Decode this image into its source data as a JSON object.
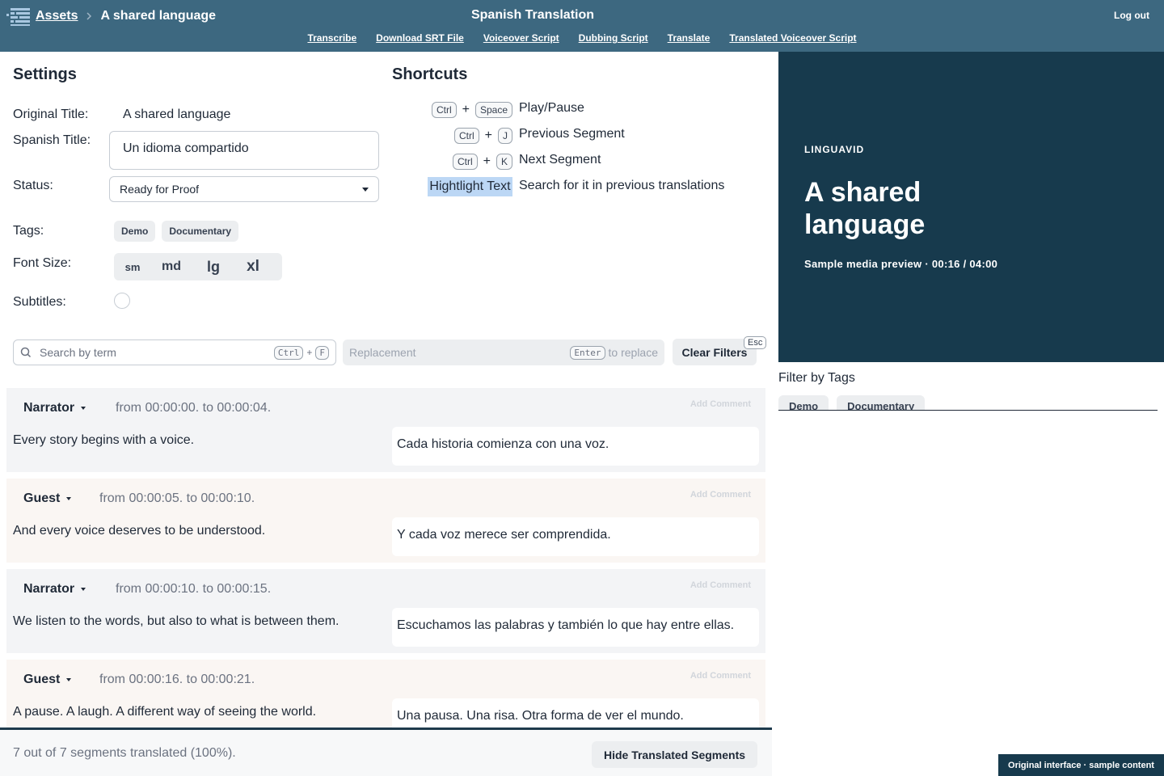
{
  "header": {
    "breadcrumb_root": "Assets",
    "breadcrumb_current": "A shared language",
    "title": "Spanish Translation",
    "logout": "Log out",
    "nav": [
      "Transcribe",
      "Download SRT File",
      "Voiceover Script",
      "Dubbing Script",
      "Translate",
      "Translated Voiceover Script"
    ]
  },
  "settings": {
    "heading": "Settings",
    "original_title_label": "Original Title:",
    "original_title_value": "A shared language",
    "spanish_title_label": "Spanish Title:",
    "spanish_title_value": "Un idioma compartido",
    "status_label": "Status:",
    "status_value": "Ready for Proof",
    "tags_label": "Tags:",
    "tags": [
      "Demo",
      "Documentary"
    ],
    "font_size_label": "Font Size:",
    "font_sizes": [
      "sm",
      "md",
      "lg",
      "xl"
    ],
    "subtitles_label": "Subtitles:",
    "subtitles_checked": false
  },
  "shortcuts": {
    "heading": "Shortcuts",
    "items": [
      {
        "keys": [
          "Ctrl",
          "Space"
        ],
        "desc": "Play/Pause"
      },
      {
        "keys": [
          "Ctrl",
          "J"
        ],
        "desc": "Previous Segment"
      },
      {
        "keys": [
          "Ctrl",
          "K"
        ],
        "desc": "Next Segment"
      }
    ],
    "highlight_label": "Hightlight Text",
    "highlight_desc": "Search for it in previous translations",
    "plus": "+"
  },
  "search": {
    "placeholder": "Search by term",
    "key1": "Ctrl",
    "key2": "F",
    "replace_placeholder": "Replacement",
    "replace_key": "Enter",
    "replace_suffix": "to replace",
    "clear_label": "Clear Filters",
    "clear_key": "Esc"
  },
  "segments": [
    {
      "speaker": "Narrator",
      "timing": "from 00:00:00. to 00:00:04.",
      "source": "Every story begins with a voice.",
      "target": "Cada historia comienza con una voz.",
      "comment": "Add Comment"
    },
    {
      "speaker": "Guest",
      "timing": "from 00:00:05. to 00:00:10.",
      "source": "And every voice deserves to be understood.",
      "target": "Y cada voz merece ser comprendida.",
      "comment": "Add Comment"
    },
    {
      "speaker": "Narrator",
      "timing": "from 00:00:10. to 00:00:15.",
      "source": "We listen to the words, but also to what is between them.",
      "target": "Escuchamos las palabras y también lo que hay entre ellas.",
      "comment": "Add Comment"
    },
    {
      "speaker": "Guest",
      "timing": "from 00:00:16. to 00:00:21.",
      "source": "A pause. A laugh. A different way of seeing the world.",
      "target": "Una pausa. Una risa. Otra forma de ver el mundo.",
      "comment": "Add Comment"
    }
  ],
  "footer": {
    "progress_text": "7 out of 7 segments translated (100%).",
    "hide_button": "Hide Translated Segments"
  },
  "preview": {
    "brand": "LINGUAVID",
    "title": "A shared language",
    "meta": "Sample media preview · 00:16 / 04:00"
  },
  "filter": {
    "title": "Filter by Tags",
    "tags": [
      "Demo",
      "Documentary"
    ]
  },
  "badge": "Original interface · sample content",
  "colors": {
    "header_bg": "#3d6880",
    "preview_bg": "#173a4d",
    "segment_grey": "#f3f4f6",
    "segment_warm": "#faf6f3",
    "highlight": "#bcd7f5"
  }
}
